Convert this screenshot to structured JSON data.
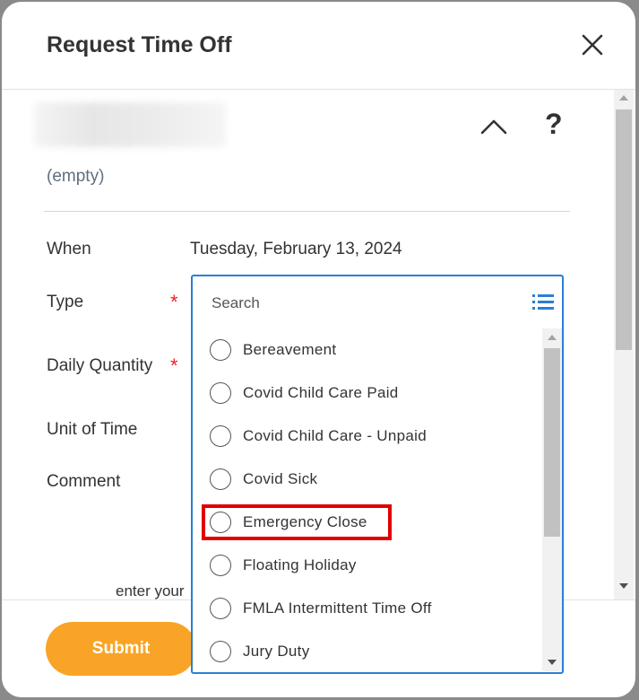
{
  "dialog": {
    "title": "Request Time Off",
    "empty_text": "(empty)"
  },
  "form": {
    "when_label": "When",
    "when_value": "Tuesday, February 13, 2024",
    "type_label": "Type",
    "daily_quantity_label": "Daily Quantity",
    "unit_of_time_label": "Unit of Time",
    "comment_label": "Comment",
    "required_mark": "*",
    "hint_text": "enter your"
  },
  "dropdown": {
    "search_placeholder": "Search",
    "options": [
      {
        "label": "Bereavement"
      },
      {
        "label": "Covid Child Care Paid"
      },
      {
        "label": "Covid Child Care - Unpaid"
      },
      {
        "label": "Covid Sick"
      },
      {
        "label": "Emergency Close"
      },
      {
        "label": "Floating Holiday"
      },
      {
        "label": "FMLA Intermittent Time Off"
      },
      {
        "label": "Jury Duty"
      }
    ],
    "highlighted_option": "Emergency Close"
  },
  "footer": {
    "submit_label": "Submit"
  },
  "colors": {
    "accent": "#2b7fd4",
    "submit": "#f9a426",
    "required": "#e22222",
    "highlight": "#e00000"
  },
  "icons": [
    "close-icon",
    "chevron-up-icon",
    "help-icon",
    "list-view-icon"
  ]
}
